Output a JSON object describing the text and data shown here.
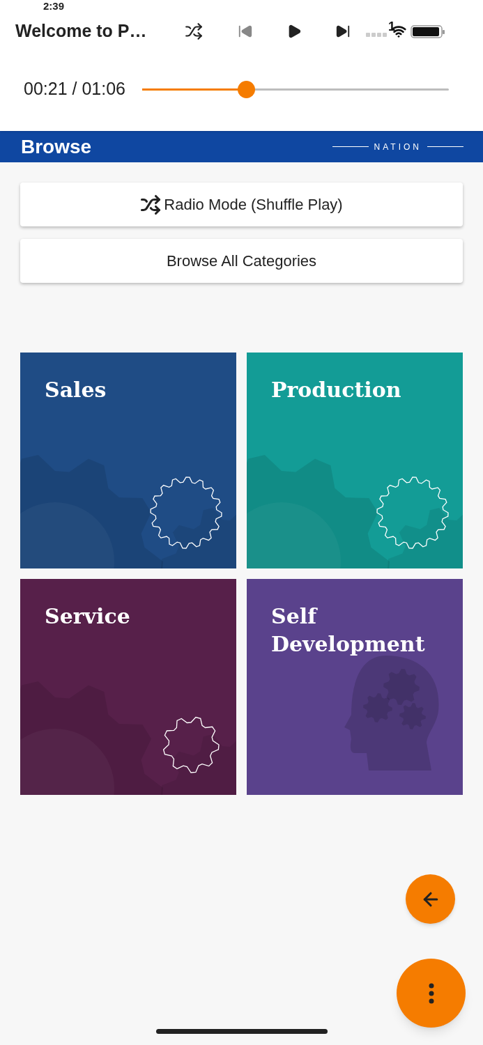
{
  "player": {
    "title": "Welcome to P…",
    "status_time": "2:39",
    "status_label": "1",
    "shuffle_on": false,
    "previous_disabled": true,
    "elapsed": "00:21 / 01:06",
    "level": 0.33
  },
  "header": {
    "title": "Browse",
    "logo": "NATION"
  },
  "buttons": [
    {
      "label": "Radio Mode (Shuffle Play)",
      "kind": "shuffle"
    },
    {
      "label": "Browse All Categories",
      "kind": "plain"
    }
  ],
  "tiles": [
    {
      "title": "Sales",
      "color": "#1f4c85",
      "kind": "gears"
    },
    {
      "title": "Production",
      "color": "#139c96",
      "kind": "gears"
    },
    {
      "title": "Service",
      "color": "#57204a",
      "kind": "gear"
    },
    {
      "title": "Self Development",
      "color": "#5a428c",
      "kind": "head"
    }
  ]
}
